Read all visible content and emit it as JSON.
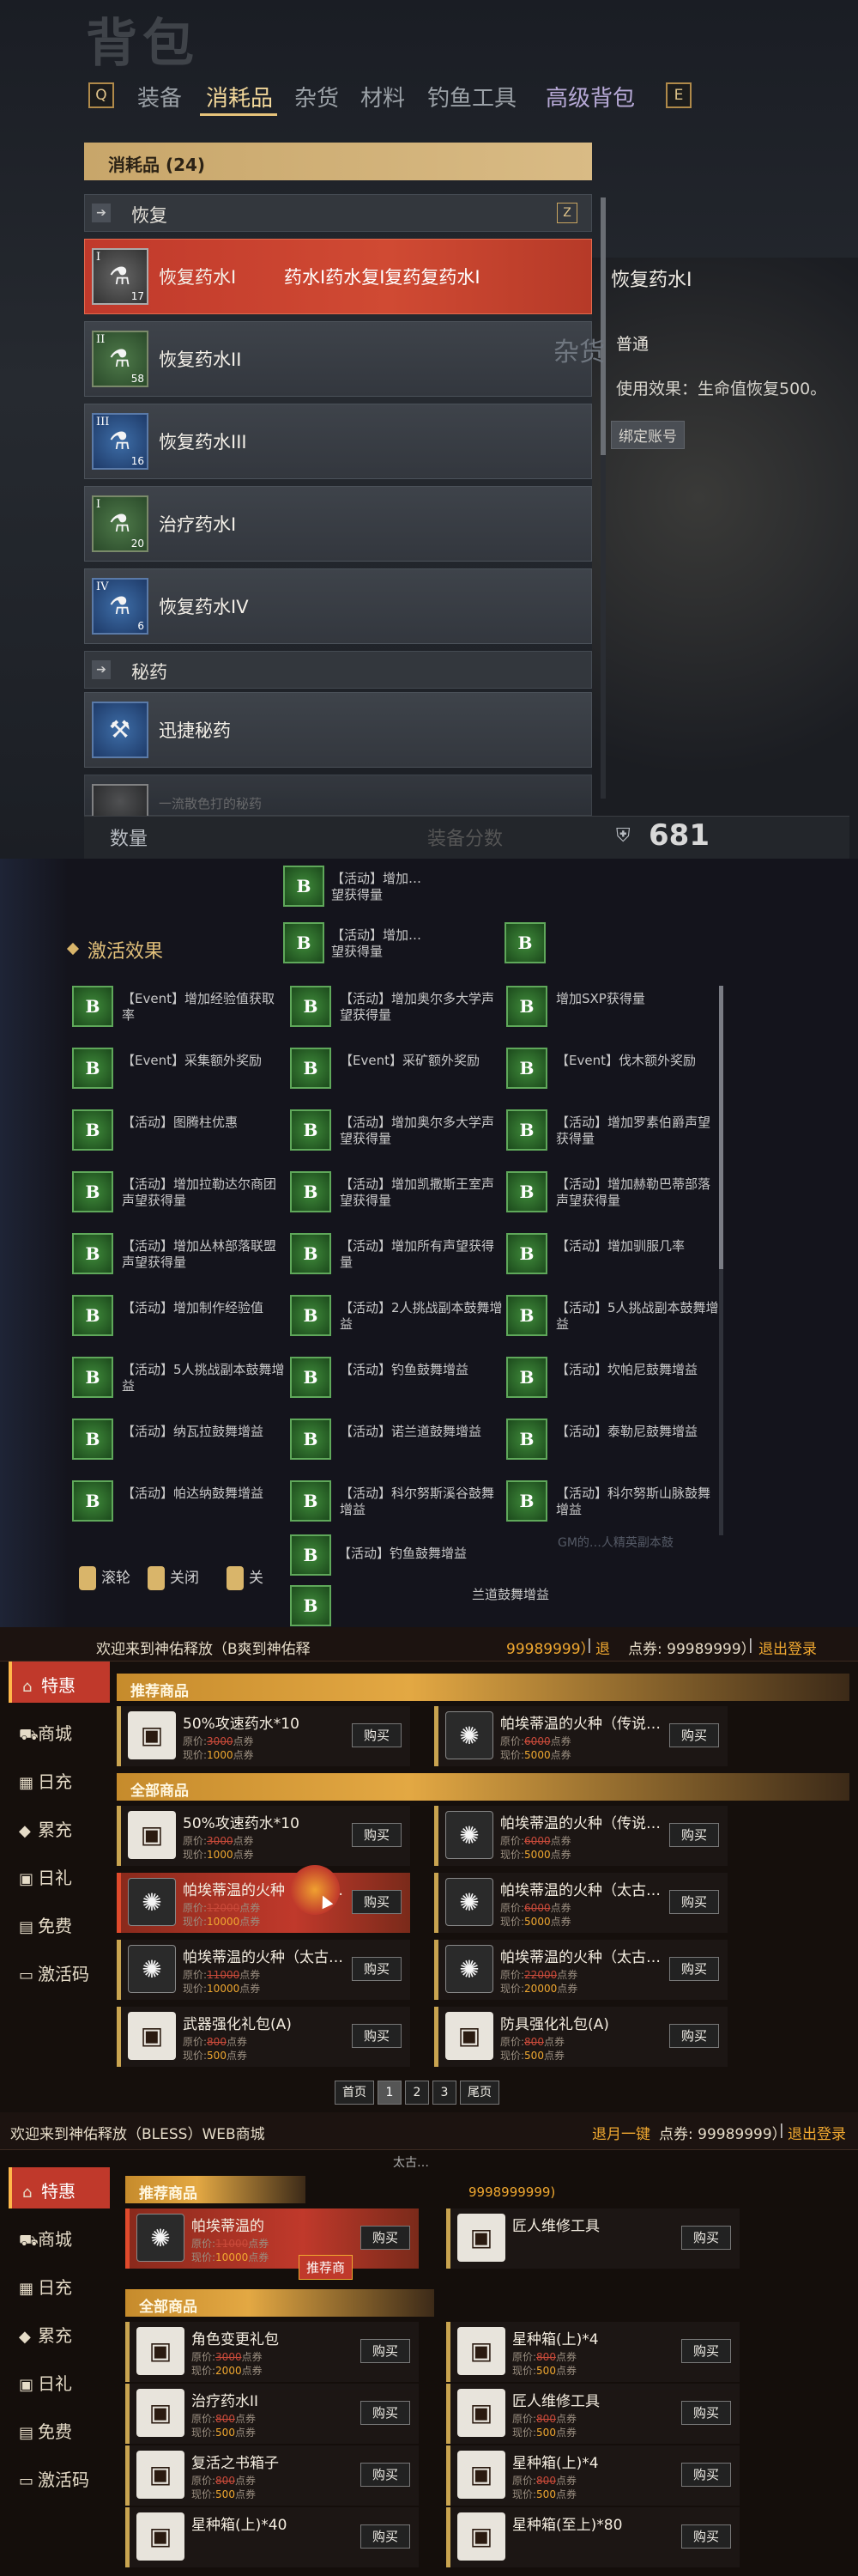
{
  "bag": {
    "title": "背包",
    "tab_key_left": "Q",
    "tab_key_right": "E",
    "tabs": [
      "装备",
      "消耗品",
      "杂货",
      "材料",
      "钓鱼工具",
      "高级背包"
    ],
    "category_header": "消耗品 (24)",
    "group_restore": "恢复",
    "group_restore_key": "Z",
    "group_secret": "秘药",
    "items": [
      {
        "name": "恢复药水I",
        "roman": "I",
        "count": "17",
        "overlay": "药水I药水复I复药复药水I"
      },
      {
        "name": "恢复药水II",
        "roman": "II",
        "count": "58"
      },
      {
        "name": "恢复药水III",
        "roman": "III",
        "count": "16"
      },
      {
        "name": "治疗药水I",
        "roman": "I",
        "count": "20"
      },
      {
        "name": "恢复药水IV",
        "roman": "IV",
        "count": "6"
      },
      {
        "name": "迅捷秘药",
        "roman": "",
        "count": ""
      },
      {
        "name": "一流散色打的秘药",
        "roman": "",
        "count": ""
      }
    ],
    "detail": {
      "name": "恢复药水I",
      "category_ghost": "杂货",
      "rarity": "普通",
      "effect": "使用效果：生命值恢复500。",
      "bind": "绑定账号"
    },
    "bottom": {
      "qty_label": "数量",
      "ghost_label": "装备分数",
      "currency_value": "681"
    }
  },
  "buffs": {
    "section_title": "激活效果",
    "top_items": [
      {
        "label": "【活动】增加…望获得量",
        "icon": "B"
      },
      {
        "label": "【活动】增加…望获得量",
        "icon": "B"
      },
      {
        "label": "",
        "icon": "B"
      }
    ],
    "items": [
      {
        "label": "【Event】增加经验值获取率",
        "icon": "B"
      },
      {
        "label": "【活动】增加奥尔多大学声望获得量",
        "icon": "B"
      },
      {
        "label": "增加SXP获得量",
        "icon": "B"
      },
      {
        "label": "【Event】采集额外奖励",
        "icon": "B"
      },
      {
        "label": "【Event】采矿额外奖励",
        "icon": "B"
      },
      {
        "label": "【Event】伐木额外奖励",
        "icon": "B"
      },
      {
        "label": "【活动】图腾柱优惠",
        "icon": "B"
      },
      {
        "label": "【活动】增加奥尔多大学声望获得量",
        "icon": "B"
      },
      {
        "label": "【活动】增加罗素伯爵声望获得量",
        "icon": "B"
      },
      {
        "label": "【活动】增加拉勒达尔商团声望获得量",
        "icon": "B"
      },
      {
        "label": "【活动】增加凯撒斯王室声望获得量",
        "icon": "B"
      },
      {
        "label": "【活动】增加赫勒巴蒂部落声望获得量",
        "icon": "B"
      },
      {
        "label": "【活动】增加丛林部落联盟声望获得量",
        "icon": "B"
      },
      {
        "label": "【活动】增加所有声望获得量",
        "icon": "B"
      },
      {
        "label": "【活动】增加驯服几率",
        "icon": "B"
      },
      {
        "label": "【活动】增加制作经验值",
        "icon": "B"
      },
      {
        "label": "【活动】2人挑战副本鼓舞增益",
        "icon": "B"
      },
      {
        "label": "【活动】5人挑战副本鼓舞增益",
        "icon": "B"
      },
      {
        "label": "【活动】5人挑战副本鼓舞增益",
        "icon": "B"
      },
      {
        "label": "【活动】钓鱼鼓舞增益",
        "icon": "B"
      },
      {
        "label": "【活动】坎帕尼鼓舞增益",
        "icon": "B"
      },
      {
        "label": "【活动】纳瓦拉鼓舞增益",
        "icon": "B"
      },
      {
        "label": "【活动】诺兰道鼓舞增益",
        "icon": "B"
      },
      {
        "label": "【活动】泰勒尼鼓舞增益",
        "icon": "B"
      },
      {
        "label": "【活动】帕达纳鼓舞增益",
        "icon": "B"
      },
      {
        "label": "【活动】科尔努斯溪谷鼓舞增益",
        "icon": "B"
      },
      {
        "label": "【活动】科尔努斯山脉鼓舞增益",
        "icon": "B"
      }
    ],
    "bottom_items": [
      {
        "label": "【活动】钓鱼鼓舞增益",
        "icon": "B"
      },
      {
        "label": "兰道鼓舞增益",
        "icon": "B"
      }
    ],
    "controls": [
      "滚轮",
      "关闭",
      "关"
    ],
    "ghost_text": "GM的…人精英副本鼓"
  },
  "shop1": {
    "welcome": "欢迎来到神佑释放（B爽到神佑释",
    "points": "99989999）",
    "sep": "|",
    "points_label_prefix": "退",
    "points_label": "点券: 99989999）",
    "logout": "退出登录",
    "menu": [
      "特惠",
      "商城",
      "日充",
      "累充",
      "日礼",
      "免费",
      "激活码"
    ],
    "menu_icons": [
      "⌂",
      "⛟",
      "▦",
      "◆",
      "▣",
      "▤",
      "▭"
    ],
    "sec_recommend": "推荐商品",
    "sec_all": "全部商品",
    "recommend": [
      {
        "name": "50%攻速药水*10",
        "orig": "3000",
        "now": "1000",
        "icon": "▣"
      },
      {
        "name": "帕埃蒂温的火种（传说…",
        "orig": "6000",
        "now": "5000",
        "icon": "✺"
      }
    ],
    "all": [
      {
        "name": "50%攻速药水*10",
        "orig": "3000",
        "now": "1000",
        "icon": "▣"
      },
      {
        "name": "帕埃蒂温的火种（传说…",
        "orig": "6000",
        "now": "5000",
        "icon": "✺"
      },
      {
        "name": "帕埃蒂温的火种（传说…",
        "orig": "12000",
        "now": "10000",
        "icon": "✺"
      },
      {
        "name": "帕埃蒂温的火种（太古…",
        "orig": "6000",
        "now": "5000",
        "icon": "✺"
      },
      {
        "name": "帕埃蒂温的火种（太古…",
        "orig": "11000",
        "now": "10000",
        "icon": "✺"
      },
      {
        "name": "帕埃蒂温的火种（太古…",
        "orig": "22000",
        "now": "20000",
        "icon": "✺"
      },
      {
        "name": "武器强化礼包(A)",
        "orig": "800",
        "now": "500",
        "icon": "▣"
      },
      {
        "name": "防具强化礼包(A)",
        "orig": "800",
        "now": "500",
        "icon": "▣"
      }
    ],
    "orig_prefix": "原价:",
    "now_prefix": "现价:",
    "unit": "点券",
    "buy": "购买",
    "pager": [
      "首页",
      "1",
      "2",
      "3",
      "尾页"
    ]
  },
  "shop2": {
    "welcome": "欢迎来到神佑释放（BLESS）WEB商城",
    "points_prefix": "退月一键",
    "points": "点券: 99989999）",
    "sep": "|",
    "logout": "退出登录",
    "menu": [
      "特惠",
      "商城",
      "日充",
      "累充",
      "日礼",
      "免费",
      "激活码"
    ],
    "menu_icons": [
      "⌂",
      "⛟",
      "▦",
      "◆",
      "▣",
      "▤",
      "▭"
    ],
    "sec_recommend": "推荐商品",
    "sec_all": "全部商品",
    "ghost_top": "太古…",
    "ghost_points": "9998999999)",
    "ghost_recommend_tag": "推荐商",
    "recommend": [
      {
        "name": "帕埃蒂温的",
        "orig": "11000",
        "now": "10000",
        "icon": "✺"
      },
      {
        "name": "匠人维修工具",
        "orig": "",
        "now": "",
        "icon": "▣"
      }
    ],
    "all": [
      {
        "name": "角色变更礼包",
        "orig": "3000",
        "now": "2000",
        "icon": "▣"
      },
      {
        "name": "星种箱(上)*4",
        "orig": "800",
        "now": "500",
        "icon": "▣"
      },
      {
        "name": "治疗药水II",
        "orig": "800",
        "now": "500",
        "icon": "▣"
      },
      {
        "name": "匠人维修工具",
        "orig": "800",
        "now": "500",
        "icon": "▣"
      },
      {
        "name": "复活之书箱子",
        "orig": "800",
        "now": "500",
        "icon": "▣"
      },
      {
        "name": "星种箱(上)*4",
        "orig": "800",
        "now": "500",
        "icon": "▣"
      },
      {
        "name": "星种箱(上)*40",
        "orig": "",
        "now": "",
        "icon": "▣"
      },
      {
        "name": "星种箱(至上)*80",
        "orig": "",
        "now": "",
        "icon": "▣"
      }
    ],
    "orig_prefix": "原价:",
    "now_prefix": "现价:",
    "unit": "点券",
    "buy": "购买"
  },
  "colors": {
    "accent_gold": "#d9b56a",
    "selected_red": "#c0392b",
    "points_orange": "#f0a830"
  }
}
